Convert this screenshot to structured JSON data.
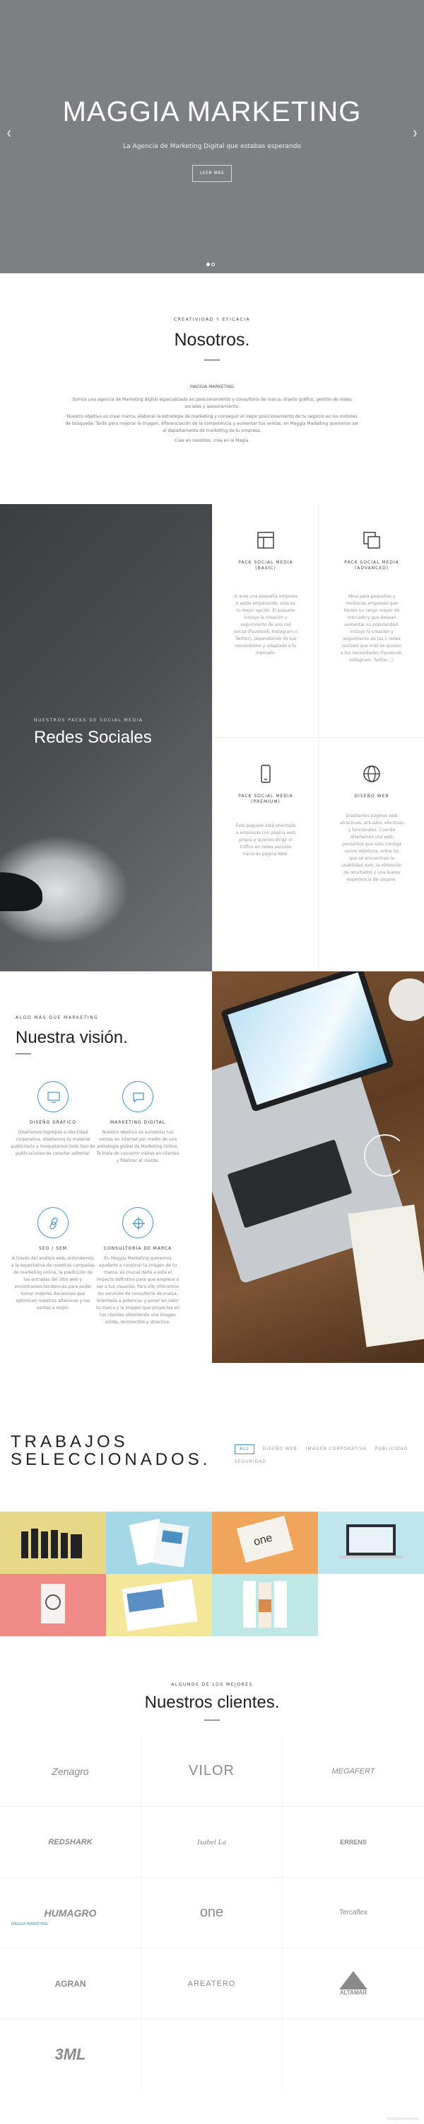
{
  "hero": {
    "title": "MAGGIA MARKETING",
    "subtitle": "La Agencia de Marketing Digital que estabas esperando",
    "button": "LEER MÁS",
    "prev_icon": "chevron-left-icon",
    "next_icon": "chevron-right-icon"
  },
  "nosotros": {
    "kicker": "CREATIVIDAD Y EFICACIA",
    "title": "Nosotros.",
    "mini": "MAGGIA MARKETING",
    "p1": "Somos una agencia de Marketing digital especializada en posicionamiento y consultoría de marca, diseño gráfico, gestión de redes sociales y asesoramiento.",
    "p2": "Nuestro objetivo es crear marca, elaborar la estrategia de marketing y conseguir el mejor posicionamiento de tu negocio en los motores de búsqueda. Tanto para mejorar la imagen, diferenciación de la competencia y aumentar tus ventas, en Maggia Marketing queremos ser el departamento de marketing de tu empresa.",
    "p3": "Crea en nosotros, crea en la Magia."
  },
  "redes": {
    "kicker": "NUESTROS PACKS DE SOCIAL MEDIA",
    "title": "Redes Sociales",
    "services": [
      {
        "icon": "layout-icon",
        "title": "PACK SOCIAL MEDIA (BASIC)",
        "desc": "Si eres una pequeña empresa o estás empezando, este es tu mejor opción. El paquete incluye la creación y seguimiento de una red social (Facebook, Instagram o Twitter), dependiendo de tus necesidades y adaptado a tu mercado."
      },
      {
        "icon": "copy-icon",
        "title": "PACK SOCIAL MEDIA (ADVANCED)",
        "desc": "Ideal para pequeñas y medianas empresas que tienen un rango mayor de mercado y que desean aumentar su popularidad. Incluye la creación y seguimiento de las 2 redes sociales que más se ajusten a tus necesidades (Facebook, Instagram, Twitter...)."
      },
      {
        "icon": "mobile-icon",
        "title": "PACK SOCIAL MEDIA (PREMIUM)",
        "desc": "Este paquete está orientado a empresas con página web propia y quieren dirigir el tráfico en redes sociales hacia su página Web."
      },
      {
        "icon": "globe-icon",
        "title": "DISEÑO WEB",
        "desc": "Diseñamos páginas web atractivas, actuales, efectivas y funcionales. Cuando diseñamos una web pensamos que esta consiga varios objetivos, entre los que se encuentran la usabilidad web, la obtención de resultados y una buena experiencia de usuario."
      }
    ]
  },
  "vision": {
    "kicker": "ALGO MÁS QUE MARKETING",
    "title": "Nuestra visión.",
    "features": [
      {
        "icon": "monitor-icon",
        "title": "DISEÑO GRÁFICO",
        "desc": "Diseñamos logotipos e identidad corporativa, diseñamos tu material publicitario y maquetamos todo tipo de publicaciones de caracter editorial."
      },
      {
        "icon": "chat-icon",
        "title": "MARKETING DIGITAL",
        "desc": "Nuestro objetivo es aumentar tus ventas en internet por medio de una estrategia global de Marketing Online. Te trata de convertir visitas en clientes y fidelizar al cliente."
      },
      {
        "icon": "link-icon",
        "title": "SEO / SEM",
        "desc": "A través del análisis web, entendemos a la expectativa de nuestras campañas de marketing online, la predicción de las entradas del sitio web y encontramos tendencias para poder tomar mejores decisiones que optimicen nuestros altavoces y tus ventas a mejor."
      },
      {
        "icon": "crosshair-icon",
        "title": "CONSULTORÍA DE MARCA",
        "desc": "En Maggia Marketing queremos ayudarte a construir la imagen de tu marca, es crucial darle a ésta el impacto definitivo para que empiece a ser a tus usuarios. Para ello ofrecemos los servicios de consultoría de marca, orientada a potenciar y poner en valor tu marca y la imagen que proyectas en tus clientes obteniendo una imagen sólida, reconocible y atractiva."
      }
    ]
  },
  "trabajos": {
    "title_line1": "TRABAJOS",
    "title_line2": "SELECCIONADOS.",
    "filters": [
      "ALL",
      "DISEÑO WEB",
      "IMAGEN CORPORATIVA",
      "PUBLICIDAD",
      "SEGURIDAD"
    ],
    "tile_colors": [
      "#e6d886",
      "#a5d8e6",
      "#f0a55a",
      "#bfe6ef",
      "#f08a86",
      "#f4e79a",
      "#bfe7e6"
    ]
  },
  "clientes": {
    "kicker": "ALGUNOS DE LOS MEJORES",
    "title": "Nuestros clientes.",
    "logos": [
      "Zenagro",
      "VILOR",
      "MEGAFERT",
      "REDSHARK",
      "Isabel La",
      "ERRENS",
      "HUMAGRO",
      "one",
      "Tercaflex",
      "AGRAN",
      "AREATERO",
      "ALTAMAR",
      "3ML"
    ]
  },
  "side_tag": "MAGGIA MARKETING",
  "bottom_tag": "maggiamarketing"
}
